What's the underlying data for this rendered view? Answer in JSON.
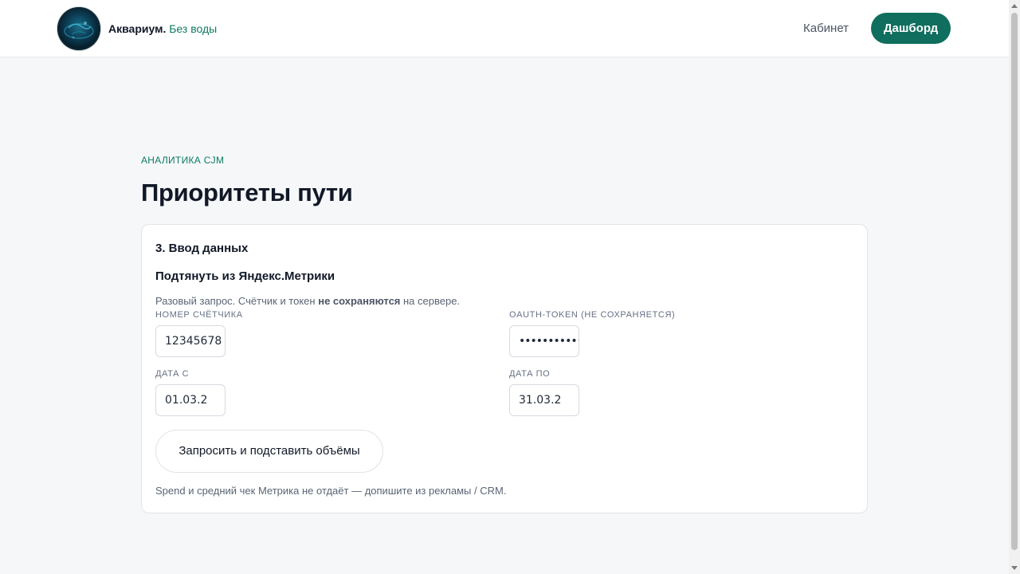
{
  "header": {
    "brand_name": "Аквариум.",
    "brand_tagline": "Без воды",
    "nav_cabinet": "Кабинет",
    "nav_dashboard": "Дашборд",
    "accent_color": "#0f6e5d"
  },
  "main": {
    "eyebrow": "АНАЛИТИКА CJM",
    "title": "Приоритеты пути"
  },
  "card": {
    "section_title": "3. Ввод данных",
    "subsection_title": "Подтянуть из Яндекс.Метрики",
    "note_before": "Разовый запрос. Счётчик и токен ",
    "note_bold": "не сохраняются",
    "note_after": " на сервере.",
    "fields": {
      "counter_label": "НОМЕР СЧЁТЧИКА",
      "counter_value": "12345678",
      "token_label": "OAUTH-TOKEN (НЕ СОХРАНЯЕТСЯ)",
      "token_value": "••••••••••••",
      "date_from_label": "ДАТА С",
      "date_from_value": "01.03.2",
      "date_to_label": "ДАТА ПО",
      "date_to_value": "31.03.2"
    },
    "request_button": "Запросить и подставить объёмы",
    "footnote": "Spend и средний чек Метрика не отдаёт — допишите из рекламы / CRM."
  }
}
